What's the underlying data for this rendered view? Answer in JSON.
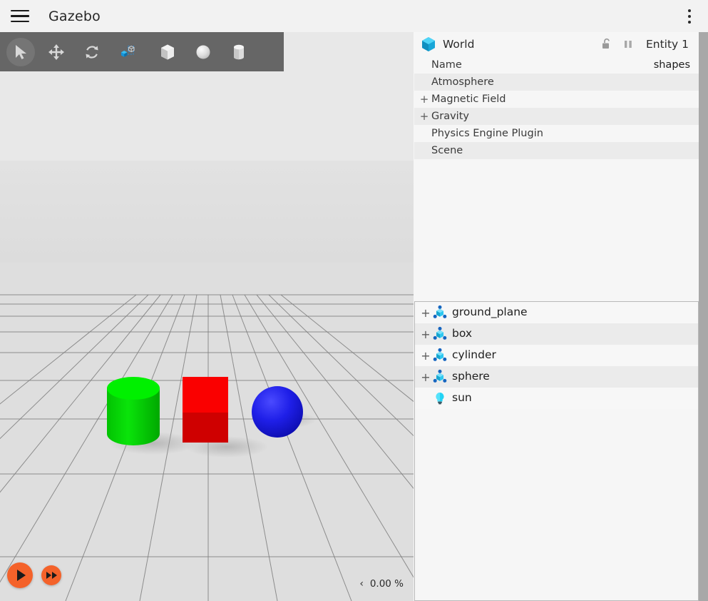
{
  "window": {
    "title": "Gazebo",
    "menu_icon": "hamburger-icon",
    "overflow_icon": "kebab-menu-icon"
  },
  "toolbar": {
    "tools": [
      {
        "name": "select-tool",
        "icon": "cursor-arrow-icon",
        "active": true
      },
      {
        "name": "translate-tool",
        "icon": "move-arrows-icon",
        "active": false
      },
      {
        "name": "rotate-tool",
        "icon": "rotate-arrows-icon",
        "active": false
      },
      {
        "name": "transform-tool",
        "icon": "scale-cube-icon",
        "active": false
      },
      {
        "name": "spawn-box",
        "icon": "box-shape-icon",
        "active": false
      },
      {
        "name": "spawn-sphere",
        "icon": "sphere-shape-icon",
        "active": false
      },
      {
        "name": "spawn-cylinder",
        "icon": "cylinder-shape-icon",
        "active": false
      }
    ]
  },
  "viewport": {
    "play_label": "play",
    "step_label": "step-forward",
    "collapse_arrow": "‹",
    "real_time_factor": "0.00 %",
    "scene_objects": [
      {
        "name": "cylinder",
        "color": "#00d800",
        "top_color": "#00f000"
      },
      {
        "name": "box",
        "color": "#cf0000",
        "top_color": "#fa0000"
      },
      {
        "name": "sphere",
        "color": "#1a1ae0",
        "top_color": "#3838ff"
      }
    ],
    "sky_color": "#e8e8e8",
    "ground_color": "#dedede",
    "grid_color": "#808080"
  },
  "inspector": {
    "title": "World",
    "icon": "world-cube-icon",
    "lock_icon": "unlocked-padlock-icon",
    "pause_icon": "pause-icon",
    "entity_label": "Entity 1",
    "properties": [
      {
        "expander": "",
        "name": "Name",
        "value": "shapes"
      },
      {
        "expander": "",
        "name": "Atmosphere",
        "value": ""
      },
      {
        "expander": "+",
        "name": "Magnetic Field",
        "value": ""
      },
      {
        "expander": "+",
        "name": "Gravity",
        "value": ""
      },
      {
        "expander": "",
        "name": "Physics Engine Plugin",
        "value": ""
      },
      {
        "expander": "",
        "name": "Scene",
        "value": ""
      }
    ]
  },
  "entity_tree": {
    "items": [
      {
        "expander": "+",
        "icon": "model-node-icon",
        "label": "ground_plane"
      },
      {
        "expander": "+",
        "icon": "model-node-icon",
        "label": "box"
      },
      {
        "expander": "+",
        "icon": "model-node-icon",
        "label": "cylinder"
      },
      {
        "expander": "+",
        "icon": "model-node-icon",
        "label": "sphere"
      },
      {
        "expander": "",
        "icon": "light-bulb-icon",
        "label": "sun"
      }
    ]
  },
  "colors": {
    "accent_orange": "#f4622a",
    "toolbar_bg": "#666666",
    "panel_bg": "#f6f6f6",
    "row_alt": "#ebebeb",
    "icon_cyan": "#29c5f6",
    "icon_blue": "#1f6fb5"
  }
}
